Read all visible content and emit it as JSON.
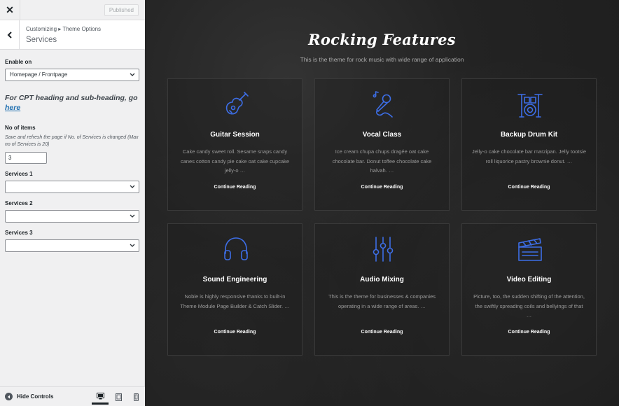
{
  "topbar": {
    "published_label": "Published"
  },
  "section": {
    "breadcrumb": "Customizing ▸ Theme Options",
    "title": "Services"
  },
  "controls": {
    "enable_on": {
      "label": "Enable on",
      "value": "Homepage / Frontpage"
    },
    "cpt_note": {
      "text": "For CPT heading and sub-heading, go",
      "link": "here"
    },
    "num_items": {
      "label": "No of items",
      "description": "Save and refresh the page if No. of Services is changed (Max no of Services is 20)",
      "value": "3"
    },
    "services": [
      {
        "label": "Services 1",
        "value": ""
      },
      {
        "label": "Services 2",
        "value": ""
      },
      {
        "label": "Services 3",
        "value": ""
      }
    ]
  },
  "footer": {
    "hide_controls_label": "Hide Controls"
  },
  "preview": {
    "heading": "Rocking Features",
    "subheading": "This is the theme for rock music with wide range of application",
    "accent_color": "#3d6ee6",
    "cards": [
      {
        "icon": "guitar-icon",
        "title": "Guitar Session",
        "text": "Cake candy sweet roll. Sesame snaps candy canes cotton candy pie cake oat cake cupcake jelly-o …",
        "more": "Continue Reading"
      },
      {
        "icon": "microphone-icon",
        "title": "Vocal Class",
        "text": "Ice cream chupa chups dragée oat cake chocolate bar. Donut toffee chocolate cake halvah. …",
        "more": "Continue Reading"
      },
      {
        "icon": "drum-kit-icon",
        "title": "Backup Drum Kit",
        "text": "Jelly-o cake chocolate bar marzipan. Jelly tootsie roll liquorice pastry brownie donut. …",
        "more": "Continue Reading"
      },
      {
        "icon": "headphones-icon",
        "title": "Sound Engineering",
        "text": "Noble is highly responsive thanks to built-in Theme Module Page Builder & Catch Slider. …",
        "more": "Continue Reading"
      },
      {
        "icon": "mixer-sliders-icon",
        "title": "Audio Mixing",
        "text": "This is the theme for businesses & companies operating in a wide range of areas. …",
        "more": "Continue Reading"
      },
      {
        "icon": "clapperboard-icon",
        "title": "Video Editing",
        "text": "Picture, too, the sudden shifting of the attention, the swiftly spreading coils and bellyings of that …",
        "more": "Continue Reading"
      }
    ]
  }
}
